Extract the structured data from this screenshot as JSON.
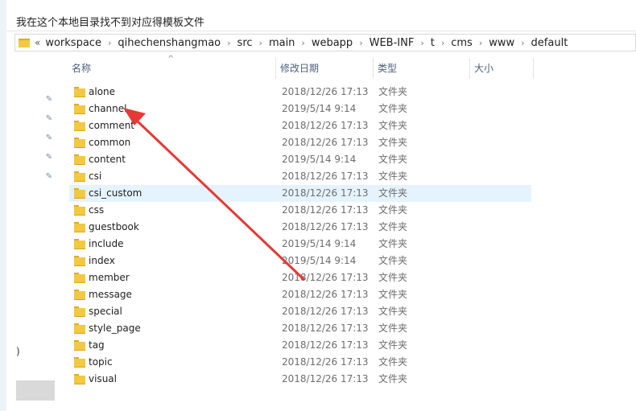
{
  "question": "我在这个本地目录找不到对应得模板文件",
  "address": {
    "back_glyph": "«",
    "crumbs": [
      "workspace",
      "qihechenshangmao",
      "src",
      "main",
      "webapp",
      "WEB-INF",
      "t",
      "cms",
      "www",
      "default"
    ],
    "separator": "›"
  },
  "columns": {
    "name": "名称",
    "date": "修改日期",
    "type": "类型",
    "size": "大小"
  },
  "files": [
    {
      "name": "alone",
      "date": "2018/12/26 17:13",
      "type": "文件夹"
    },
    {
      "name": "channel",
      "date": "2019/5/14 9:14",
      "type": "文件夹"
    },
    {
      "name": "comment",
      "date": "2018/12/26 17:13",
      "type": "文件夹"
    },
    {
      "name": "common",
      "date": "2018/12/26 17:13",
      "type": "文件夹"
    },
    {
      "name": "content",
      "date": "2019/5/14 9:14",
      "type": "文件夹"
    },
    {
      "name": "csi",
      "date": "2018/12/26 17:13",
      "type": "文件夹"
    },
    {
      "name": "csi_custom",
      "date": "2018/12/26 17:13",
      "type": "文件夹",
      "selected": true
    },
    {
      "name": "css",
      "date": "2018/12/26 17:13",
      "type": "文件夹"
    },
    {
      "name": "guestbook",
      "date": "2018/12/26 17:13",
      "type": "文件夹"
    },
    {
      "name": "include",
      "date": "2019/5/14 9:14",
      "type": "文件夹"
    },
    {
      "name": "index",
      "date": "2019/5/14 9:14",
      "type": "文件夹"
    },
    {
      "name": "member",
      "date": "2018/12/26 17:13",
      "type": "文件夹"
    },
    {
      "name": "message",
      "date": "2018/12/26 17:13",
      "type": "文件夹"
    },
    {
      "name": "special",
      "date": "2018/12/26 17:13",
      "type": "文件夹"
    },
    {
      "name": "style_page",
      "date": "2018/12/26 17:13",
      "type": "文件夹"
    },
    {
      "name": "tag",
      "date": "2018/12/26 17:13",
      "type": "文件夹"
    },
    {
      "name": "topic",
      "date": "2018/12/26 17:13",
      "type": "文件夹"
    },
    {
      "name": "visual",
      "date": "2018/12/26 17:13",
      "type": "文件夹"
    }
  ],
  "nav": {
    "pin_icon": "pin-icon",
    "pin_count": 5,
    "paren": ")"
  },
  "colors": {
    "folder": "#f3c843",
    "selected_row": "#e5f3ff",
    "arrow": "#e53935"
  }
}
